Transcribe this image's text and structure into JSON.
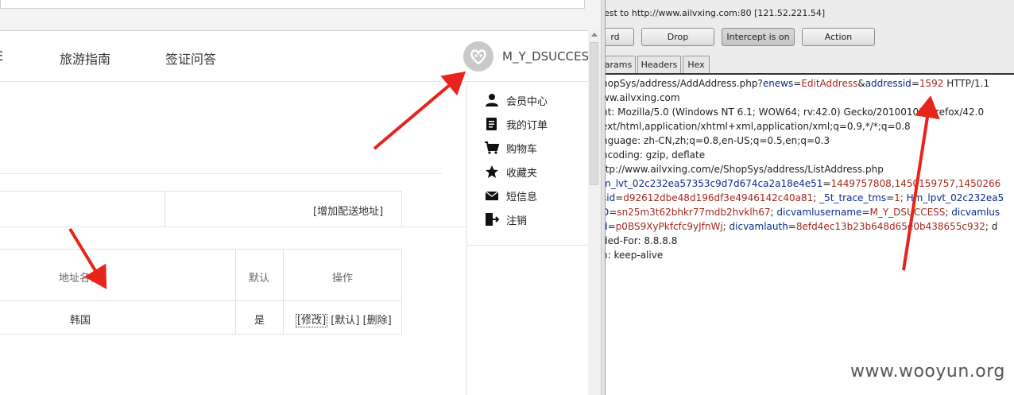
{
  "browser": {
    "nav_items": [
      "E",
      "旅游指南",
      "签证问答"
    ],
    "username": "M_Y_DSUCCESS",
    "user_menu": [
      {
        "label": "会员中心",
        "icon": "person-icon"
      },
      {
        "label": "我的订单",
        "icon": "order-list-icon"
      },
      {
        "label": "购物车",
        "icon": "cart-icon"
      },
      {
        "label": "收藏夹",
        "icon": "star-icon"
      },
      {
        "label": "短信息",
        "icon": "envelope-icon"
      },
      {
        "label": "注销",
        "icon": "logout-icon"
      }
    ],
    "add_address_link": "[增加配送地址]",
    "address_table": {
      "headers": [
        "地址名称",
        "默认",
        "操作"
      ],
      "rows": [
        {
          "name": "韩国",
          "default": "是",
          "actions": [
            "[修改]",
            "[默认]",
            "[删除]"
          ]
        }
      ]
    }
  },
  "burp": {
    "request_title": "est to http://www.ailvxing.com:80  [121.52.221.54]",
    "buttons": [
      {
        "label": "rd",
        "active": false
      },
      {
        "label": "Drop",
        "active": false
      },
      {
        "label": "Intercept is on",
        "active": true
      },
      {
        "label": "Action",
        "active": false
      }
    ],
    "tabs": [
      "arams",
      "Headers",
      "Hex"
    ],
    "request_lines": [
      [
        {
          "t": "hopSys/address/AddAddress.php?",
          "c": "e"
        },
        {
          "t": "enews",
          "c": "k"
        },
        {
          "t": "=",
          "c": "e"
        },
        {
          "t": "EditAddress",
          "c": "v"
        },
        {
          "t": "&",
          "c": "e"
        },
        {
          "t": "addressid",
          "c": "k"
        },
        {
          "t": "=",
          "c": "e"
        },
        {
          "t": "1592",
          "c": "v"
        },
        {
          "t": " HTTP/1.1",
          "c": "e"
        }
      ],
      [
        {
          "t": "ww.ailvxing.com",
          "c": "e"
        }
      ],
      [
        {
          "t": "nt: Mozilla/5.0 (Windows NT 6.1; WOW64; rv:42.0) Gecko/20100101 Firefox/42.0",
          "c": "e"
        }
      ],
      [
        {
          "t": "ext/html,application/xhtml+xml,application/xml;q=0.9,*/*;q=0.8",
          "c": "e"
        }
      ],
      [
        {
          "t": "nguage: zh-CN,zh;q=0.8,en-US;q=0.5,en;q=0.3",
          "c": "e"
        }
      ],
      [
        {
          "t": "ncoding: gzip, deflate",
          "c": "e"
        }
      ],
      [
        {
          "t": "ttp://www.ailvxing.com/e/ShopSys/address/ListAddress.php",
          "c": "e"
        }
      ],
      [
        {
          "t": "m_lvt_02c232ea57353c9d7d674ca2a18e4e51",
          "c": "k"
        },
        {
          "t": "=",
          "c": "e"
        },
        {
          "t": "1449757808,1450159757,1450266",
          "c": "v"
        }
      ],
      [
        {
          "t": "sid",
          "c": "k"
        },
        {
          "t": "=",
          "c": "e"
        },
        {
          "t": "d92612dbe48d196df3e4946142c40a81",
          "c": "v"
        },
        {
          "t": "; ",
          "c": "e"
        },
        {
          "t": "_5t_trace_tms",
          "c": "k"
        },
        {
          "t": "=",
          "c": "e"
        },
        {
          "t": "1; ",
          "c": "v"
        },
        {
          "t": "Hm_lpvt_02c232ea5",
          "c": "k"
        }
      ],
      [
        {
          "t": "D",
          "c": "k"
        },
        {
          "t": "=",
          "c": "e"
        },
        {
          "t": "sn25m3t62bhkr77mdb2hvklh67",
          "c": "v"
        },
        {
          "t": "; ",
          "c": "e"
        },
        {
          "t": "dicvamlusername",
          "c": "k"
        },
        {
          "t": "=",
          "c": "e"
        },
        {
          "t": "M_Y_DSUCCESS",
          "c": "v"
        },
        {
          "t": "; ",
          "c": "e"
        },
        {
          "t": "dicvamlus",
          "c": "k"
        }
      ],
      [
        {
          "t": "d",
          "c": "k"
        },
        {
          "t": "=",
          "c": "e"
        },
        {
          "t": "p0BS9XyPkfcfc9yJfnWj",
          "c": "v"
        },
        {
          "t": "; ",
          "c": "e"
        },
        {
          "t": "dicvamlauth",
          "c": "k"
        },
        {
          "t": "=",
          "c": "e"
        },
        {
          "t": "8efd4ec13b23b648d65e0b438655c932",
          "c": "v"
        },
        {
          "t": "; d",
          "c": "e"
        }
      ],
      [
        {
          "t": "ded-For: 8.8.8.8",
          "c": "e"
        }
      ],
      [
        {
          "t": "n: keep-alive",
          "c": "e"
        }
      ]
    ]
  },
  "watermark": "www.wooyun.org",
  "colors": {
    "annotation_arrow": "#e8231b",
    "param_name": "#0b2b8a",
    "param_value": "#a3281c"
  }
}
